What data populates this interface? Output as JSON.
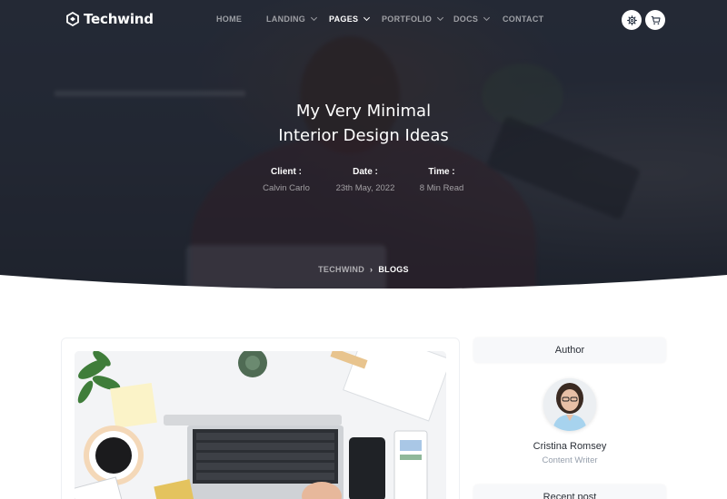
{
  "brand": {
    "name": "Techwind"
  },
  "nav": {
    "items": [
      {
        "label": "HOME"
      },
      {
        "label": "LANDING"
      },
      {
        "label": "PAGES"
      },
      {
        "label": "PORTFOLIO"
      },
      {
        "label": "DOCS"
      },
      {
        "label": "CONTACT"
      }
    ],
    "active": "PAGES"
  },
  "hero": {
    "title_line1": "My Very Minimal",
    "title_line2": "Interior Design Ideas",
    "meta": [
      {
        "label": "Client :",
        "value": "Calvin Carlo"
      },
      {
        "label": "Date :",
        "value": "23th May, 2022"
      },
      {
        "label": "Time :",
        "value": "8 Min Read"
      }
    ]
  },
  "breadcrumb": {
    "root": "TECHWIND",
    "separator": "›",
    "current": "BLOGS"
  },
  "sidebar": {
    "author_heading": "Author",
    "author_name": "Cristina Romsey",
    "author_role": "Content Writer",
    "recent_heading": "Recent post"
  },
  "colors": {
    "hero_overlay": "#2b2f3b",
    "accent": "#4f46e5",
    "muted": "#94a3b8"
  }
}
